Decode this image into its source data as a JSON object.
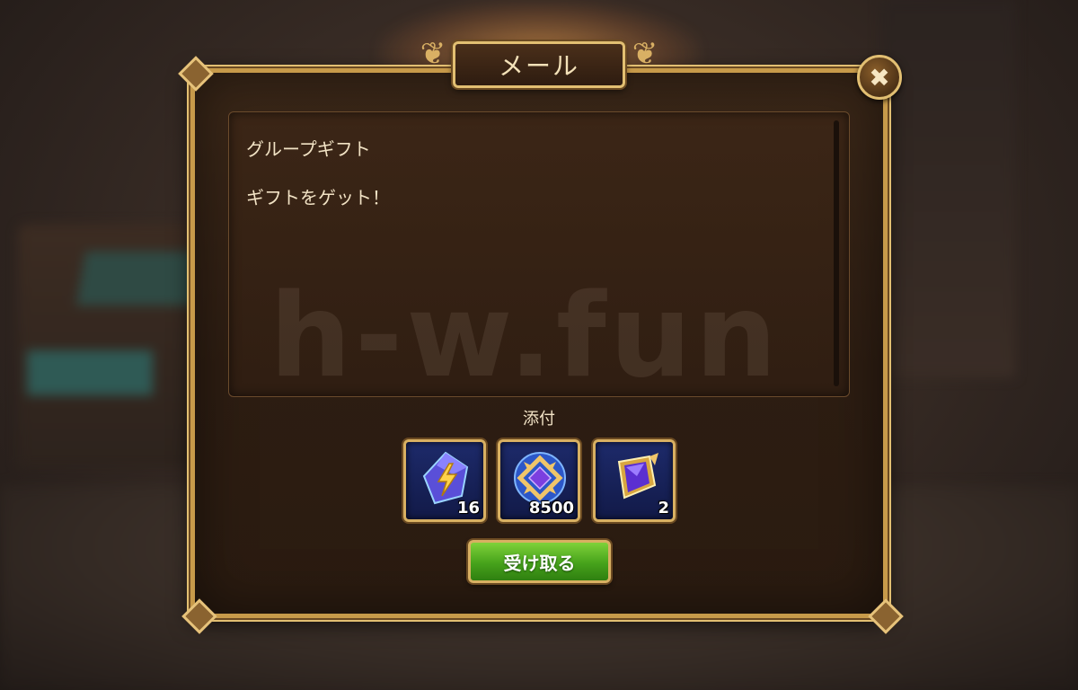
{
  "dialog": {
    "title": "メール",
    "close_icon": "close-icon"
  },
  "message": {
    "subject": "グループギフト",
    "body": "ギフトをゲット！"
  },
  "watermark": "h-w.fun",
  "attachments": {
    "label": "添付",
    "items": [
      {
        "icon": "lightning-crystal-icon",
        "quantity": "16"
      },
      {
        "icon": "emblem-coin-icon",
        "quantity": "8500"
      },
      {
        "icon": "gem-shard-icon",
        "quantity": "2"
      }
    ]
  },
  "claim_button": {
    "label": "受け取る"
  },
  "colors": {
    "accent_gold": "#d8b062",
    "button_green": "#46a21b",
    "panel_brown": "#2d1d12"
  }
}
